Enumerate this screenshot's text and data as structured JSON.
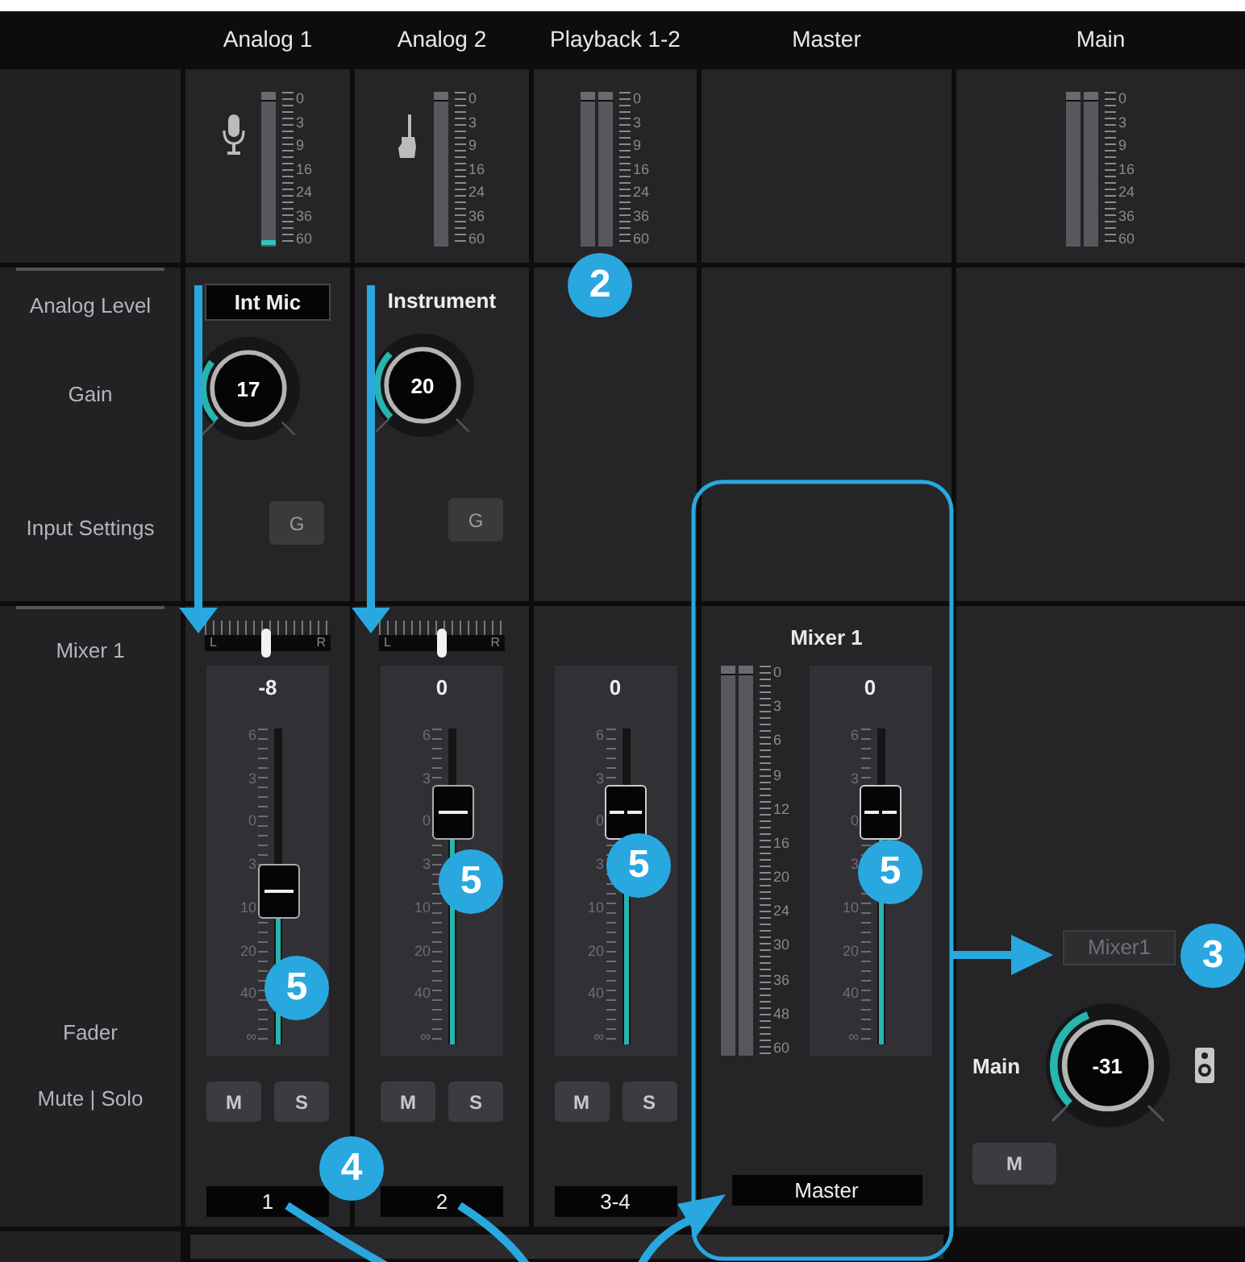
{
  "columns": [
    {
      "title": "Analog 1",
      "meter": {
        "kind": "mono",
        "level": 0.04,
        "scale": [
          "0",
          "3",
          "9",
          "16",
          "24",
          "36",
          "60"
        ]
      }
    },
    {
      "title": "Analog 2",
      "meter": {
        "kind": "mono",
        "scale": [
          "0",
          "3",
          "9",
          "16",
          "24",
          "36",
          "60"
        ]
      }
    },
    {
      "title": "Playback 1-2",
      "meter": {
        "kind": "stereo",
        "scale": [
          "0",
          "3",
          "9",
          "16",
          "24",
          "36",
          "60"
        ]
      }
    },
    {
      "title": "Master"
    },
    {
      "title": "Main",
      "meter": {
        "kind": "stereo",
        "scale": [
          "0",
          "3",
          "9",
          "16",
          "24",
          "36",
          "60"
        ]
      }
    }
  ],
  "row_labels": [
    "Analog Level",
    "Gain",
    "Input Settings",
    "Mixer 1",
    "Fader",
    "Mute | Solo"
  ],
  "inputs": [
    {
      "source": "Int Mic",
      "kind": "field",
      "gain": "17",
      "settings_button": "G"
    },
    {
      "source": "Instrument",
      "kind": "plain",
      "gain": "20",
      "settings_button": "G"
    }
  ],
  "strips": [
    {
      "pan": {
        "level": 0.49,
        "left": "L",
        "right": "R"
      },
      "value": "-8",
      "kind": "mono",
      "level": 0.48,
      "scale": [
        "6",
        "3",
        "0",
        "3",
        "10",
        "20",
        "40",
        "∞"
      ],
      "mute": "M",
      "solo": "S",
      "name": "1"
    },
    {
      "pan": {
        "level": 0.5,
        "left": "L",
        "right": "R"
      },
      "value": "0",
      "kind": "mono",
      "level": 0.73,
      "scale": [
        "6",
        "3",
        "0",
        "3",
        "10",
        "20",
        "40",
        "∞"
      ],
      "mute": "M",
      "solo": "S",
      "name": "2"
    },
    {
      "value": "0",
      "kind": "stereo",
      "level": 0.73,
      "scale": [
        "6",
        "3",
        "0",
        "3",
        "10",
        "20",
        "40",
        "∞"
      ],
      "mute": "M",
      "solo": "S",
      "name": "3-4"
    }
  ],
  "master": {
    "title": "Mixer 1",
    "meter": {
      "kind": "stereo",
      "scale": [
        "0",
        "3",
        "6",
        "9",
        "12",
        "16",
        "20",
        "24",
        "30",
        "36",
        "48",
        "60"
      ]
    },
    "fader": {
      "value": "0",
      "kind": "stereo",
      "level": 0.73,
      "scale": [
        "6",
        "3",
        "0",
        "3",
        "10",
        "20",
        "40",
        "∞"
      ]
    },
    "name": "Master"
  },
  "main": {
    "source": "Mixer1",
    "label": "Main",
    "value": "-31",
    "mute": "M"
  },
  "callouts": [
    {
      "text": "2"
    },
    {
      "text": "5"
    },
    {
      "text": "5"
    },
    {
      "text": "5"
    },
    {
      "text": "5"
    },
    {
      "text": "3"
    },
    {
      "text": "4"
    }
  ]
}
